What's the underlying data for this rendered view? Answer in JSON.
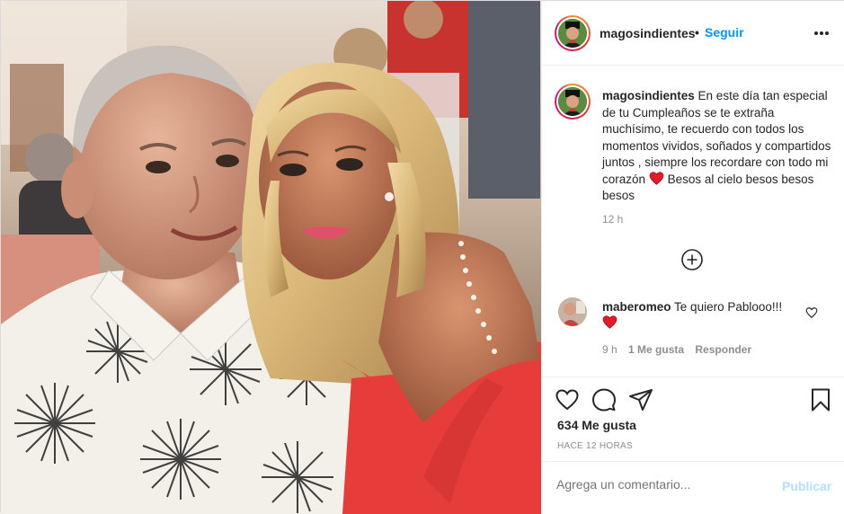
{
  "post": {
    "username": "magosindientes",
    "separator": "•",
    "follow_label": "Seguir",
    "more_icon": "more-horizontal-icon"
  },
  "caption": {
    "username": "magosindientes",
    "text": "En este día tan especial de tu Cumpleaños se te extraña muchísimo, te recuerdo con todos los momentos vividos, soñados y compartidos juntos , siempre los recordare con todo mi corazón",
    "text_after_heart": "Besos al cielo besos besos besos",
    "emoji": "red-heart-icon",
    "time": "12 h"
  },
  "load_more_icon": "plus-circle-icon",
  "comments": [
    {
      "username": "maberomeo",
      "text": "Te quiero Pablooo!!!",
      "emoji": "red-heart-icon",
      "time": "9 h",
      "likes": "1 Me gusta",
      "reply": "Responder"
    }
  ],
  "actions": {
    "like_icon": "heart-outline-icon",
    "comment_icon": "comment-icon",
    "share_icon": "paper-plane-icon",
    "save_icon": "bookmark-icon"
  },
  "likes_label": "634 Me gusta",
  "timestamp": "HACE 12 HORAS",
  "add_comment": {
    "placeholder": "Agrega un comentario...",
    "publish_label": "Publicar"
  },
  "colors": {
    "link_blue": "#0095f6",
    "publish_disabled": "#b2dffc",
    "heart_red": "#ed4956",
    "muted": "#8e8e8e"
  }
}
